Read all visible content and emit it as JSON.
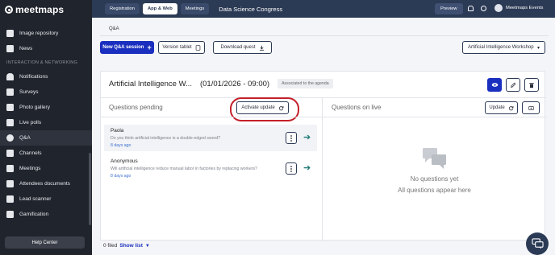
{
  "brand": {
    "name": "meetmaps"
  },
  "sidebar": {
    "items_top": [
      {
        "label": "Image repository",
        "icon": "image-icon"
      },
      {
        "label": "News",
        "icon": "news-icon"
      }
    ],
    "section_label": "INTERACTION & NETWORKING",
    "items": [
      {
        "label": "Notifications",
        "icon": "bell-icon"
      },
      {
        "label": "Surveys",
        "icon": "clipboard-icon"
      },
      {
        "label": "Photo gallery",
        "icon": "photo-icon"
      },
      {
        "label": "Live polls",
        "icon": "poll-icon"
      },
      {
        "label": "Q&A",
        "icon": "qa-icon",
        "active": true
      },
      {
        "label": "Channels",
        "icon": "channels-icon"
      },
      {
        "label": "Meetings",
        "icon": "meetings-icon"
      },
      {
        "label": "Attendees documents",
        "icon": "documents-icon"
      },
      {
        "label": "Lead scanner",
        "icon": "scanner-icon"
      },
      {
        "label": "Gamification",
        "icon": "trophy-icon"
      }
    ],
    "help_label": "Help Center"
  },
  "topbar": {
    "tabs": [
      "Registration",
      "App & Web",
      "Meetings"
    ],
    "active_tab": "App & Web",
    "event_title": "Data Science Congress",
    "preview_label": "Preview",
    "account_name": "Meetmaps Events"
  },
  "page": {
    "subtab": "Q&A",
    "new_session_label": "New Q&A session",
    "version_tablet_label": "Version tablet",
    "download_label": "Download quest",
    "session_select": "Artificial Intelligence Workshop"
  },
  "session": {
    "name": "Artificial Intelligence W...",
    "time": "(01/01/2026 - 09:00)",
    "badge": "Associated to the agenda"
  },
  "pending": {
    "title": "Questions pending",
    "activate_label": "Activate update",
    "questions": [
      {
        "author": "Paola",
        "text": "Do you think artificial intelligence is a double-edged sword?",
        "time": "8 days ago"
      },
      {
        "author": "Anonymous",
        "text": "Will artificial intelligence reduce manual labor in factories by replacing workers?",
        "time": "8 days ago"
      }
    ]
  },
  "live": {
    "title": "Questions on live",
    "update_label": "Update",
    "empty_title": "No questions yet",
    "empty_sub": "All questions appear here"
  },
  "footer": {
    "count_text": "0 filed",
    "show_list_label": "Show list"
  },
  "colors": {
    "sidebar_bg": "#20242c",
    "topbar_bg": "#2b3a55",
    "primary": "#1a2fbf",
    "highlight": "#c41f2a",
    "arrow": "#1f7a78"
  }
}
